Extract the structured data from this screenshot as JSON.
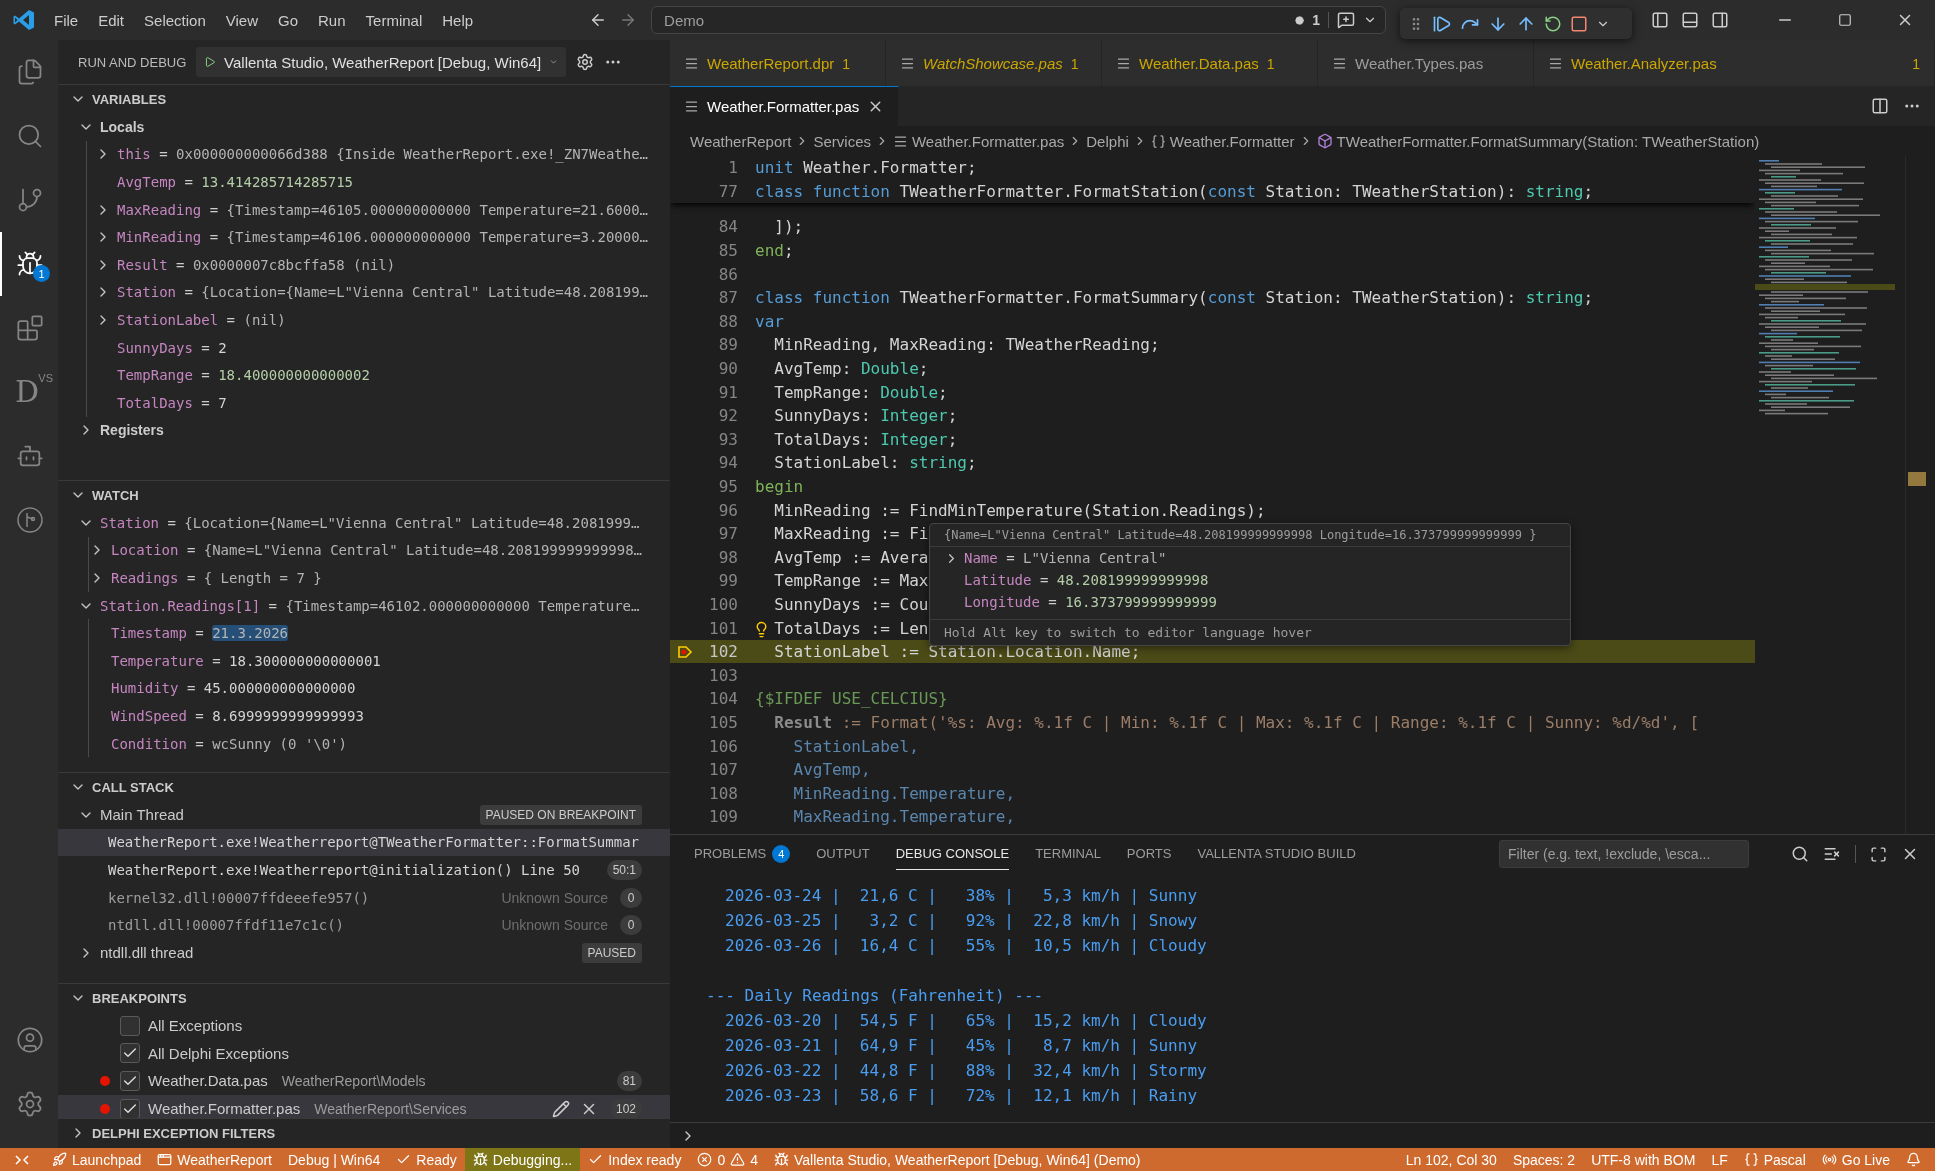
{
  "title_bar": {
    "menu": [
      "File",
      "Edit",
      "Selection",
      "View",
      "Go",
      "Run",
      "Terminal",
      "Help"
    ],
    "command_center": "Demo",
    "notification_count": "1"
  },
  "activity_bar": {
    "items": [
      {
        "kind": "explorer",
        "selected": false
      },
      {
        "kind": "search",
        "selected": false
      },
      {
        "kind": "source-control",
        "selected": false
      },
      {
        "kind": "run-debug",
        "selected": true,
        "badge": "1"
      },
      {
        "kind": "extensions",
        "selected": false
      },
      {
        "kind": "delphi",
        "selected": false,
        "text": "D",
        "superscript": "VS"
      },
      {
        "kind": "assistant",
        "selected": false
      },
      {
        "kind": "deploy",
        "selected": false
      }
    ],
    "bottom": [
      {
        "kind": "account"
      },
      {
        "kind": "settings"
      }
    ]
  },
  "sidebar": {
    "title": "RUN AND DEBUG",
    "launch_config": "Vallenta Studio, WeatherReport [Debug, Win64]",
    "variables": {
      "title": "VARIABLES",
      "expanded": true,
      "scopes": [
        {
          "name": "Locals",
          "expanded": true,
          "children": [
            {
              "name": "this",
              "separator": "=",
              "value": "0x000000000066d388 {Inside WeatherReport.exe!_ZN7Weathe…",
              "kind": "text",
              "expandable": true,
              "expanded": false
            },
            {
              "name": "AvgTemp",
              "separator": "=",
              "value": "13.414285714285715",
              "kind": "number",
              "expandable": false
            },
            {
              "name": "MaxReading",
              "separator": "=",
              "value": "{Timestamp=46105.000000000000 Temperature=21.6000…",
              "kind": "text",
              "expandable": true,
              "expanded": false
            },
            {
              "name": "MinReading",
              "separator": "=",
              "value": "{Timestamp=46106.000000000000 Temperature=3.20000…",
              "kind": "text",
              "expandable": true,
              "expanded": false
            },
            {
              "name": "Result",
              "separator": "=",
              "value": "0x0000007c8bcffa58 (nil)",
              "kind": "text",
              "expandable": true,
              "expanded": false
            },
            {
              "name": "Station",
              "separator": "=",
              "value": "{Location={Name=L\"Vienna Central\" Latitude=48.208199…",
              "kind": "text",
              "expandable": true,
              "expanded": false
            },
            {
              "name": "StationLabel",
              "separator": "=",
              "value": "(nil)",
              "kind": "text",
              "expandable": true,
              "expanded": false
            },
            {
              "name": "SunnyDays",
              "separator": "=",
              "value": "2",
              "kind": "plain",
              "expandable": false
            },
            {
              "name": "TempRange",
              "separator": "=",
              "value": "18.400000000000002",
              "kind": "number",
              "expandable": false
            },
            {
              "name": "TotalDays",
              "separator": "=",
              "value": "7",
              "kind": "plain",
              "expandable": false
            }
          ]
        },
        {
          "name": "Registers",
          "expanded": false
        }
      ]
    },
    "watch": {
      "title": "WATCH",
      "expanded": true,
      "items": [
        {
          "name": "Station",
          "separator": "=",
          "value": "{Location={Name=L\"Vienna Central\" Latitude=48.2081999…",
          "kind": "text",
          "expandable": true,
          "expanded": true,
          "children": [
            {
              "name": "Location",
              "separator": "=",
              "value": "{Name=L\"Vienna Central\" Latitude=48.208199999999998…",
              "kind": "text",
              "expandable": true,
              "expanded": false
            },
            {
              "name": "Readings",
              "separator": "=",
              "value": "{ Length = 7 }",
              "kind": "text",
              "expandable": true,
              "expanded": false
            }
          ]
        },
        {
          "name": "Station.Readings[1]",
          "separator": "=",
          "value": "{Timestamp=46102.000000000000 Temperature…",
          "kind": "text",
          "expandable": true,
          "expanded": true,
          "children": [
            {
              "name": "Timestamp",
              "separator": "=",
              "value": "21.3.2026",
              "kind": "text",
              "expandable": false,
              "highlighted": true
            },
            {
              "name": "Temperature",
              "separator": "=",
              "value": "18.300000000000001",
              "kind": "plain",
              "expandable": false,
              "highlighted": false
            },
            {
              "name": "Humidity",
              "separator": "=",
              "value": "45.000000000000000",
              "kind": "plain",
              "expandable": false,
              "highlighted": false
            },
            {
              "name": "WindSpeed",
              "separator": "=",
              "value": "8.6999999999999993",
              "kind": "plain",
              "expandable": false,
              "highlighted": false
            },
            {
              "name": "Condition",
              "separator": "=",
              "value": "wcSunny (0 '\\0')",
              "kind": "text",
              "expandable": false,
              "highlighted": false
            }
          ]
        }
      ]
    },
    "call_stack": {
      "title": "CALL STACK",
      "expanded": true,
      "threads": [
        {
          "name": "Main Thread",
          "expanded": true,
          "status": "PAUSED ON BREAKPOINT",
          "frames": [
            {
              "label": "WeatherReport.exe!Weatherreport@TWeatherFormatter::FormatSummar",
              "selected": true,
              "dimmed": false
            },
            {
              "label": "WeatherReport.exe!Weatherreport@initialization() Line 50",
              "selected": false,
              "dimmed": false,
              "badge": "50:1"
            },
            {
              "label": "kernel32.dll!00007ffdeeefe957()",
              "selected": false,
              "dimmed": true,
              "source": "Unknown Source",
              "badge": "0"
            },
            {
              "label": "ntdll.dll!00007ffdf11e7c1c()",
              "selected": false,
              "dimmed": true,
              "source": "Unknown Source",
              "badge": "0"
            }
          ]
        },
        {
          "name": "ntdll.dll thread",
          "expanded": false,
          "status": "PAUSED"
        }
      ]
    },
    "breakpoints": {
      "title": "BREAKPOINTS",
      "expanded": true,
      "items": [
        {
          "label": "All Exceptions",
          "checked": false,
          "dot": false,
          "selected": false
        },
        {
          "label": "All Delphi Exceptions",
          "checked": true,
          "dot": false,
          "selected": false
        },
        {
          "label": "Weather.Data.pas",
          "path": "WeatherReport\\Models",
          "checked": true,
          "dot": true,
          "badge": "81",
          "selected": false
        },
        {
          "label": "Weather.Formatter.pas",
          "path": "WeatherReport\\Services",
          "checked": true,
          "dot": true,
          "badge": "102",
          "selected": true
        }
      ]
    },
    "exception_filters": {
      "title": "DELPHI EXCEPTION FILTERS",
      "expanded": false
    }
  },
  "editor": {
    "tab_rows": [
      {
        "tabs": [
          {
            "label": "WeatherReport.dpr",
            "badge": "1",
            "problems": true,
            "preview": false,
            "selected": false
          },
          {
            "label": "WatchShowcase.pas",
            "badge": "1",
            "problems": true,
            "preview": true,
            "selected": false
          },
          {
            "label": "Weather.Data.pas",
            "badge": "1",
            "problems": true,
            "preview": false,
            "selected": false
          },
          {
            "label": "Weather.Types.pas",
            "problems": false,
            "preview": false,
            "selected": false
          },
          {
            "label": "Weather.Analyzer.pas",
            "badge": "1",
            "problems": true,
            "preview": false,
            "selected": false
          }
        ]
      },
      {
        "tabs": [
          {
            "label": "Weather.Formatter.pas",
            "problems": false,
            "preview": false,
            "selected": true
          }
        ]
      }
    ],
    "breadcrumbs": [
      {
        "label": "WeatherReport",
        "kind": "folder"
      },
      {
        "label": "Services",
        "kind": "folder"
      },
      {
        "label": "Weather.Formatter.pas",
        "kind": "file"
      },
      {
        "label": "Delphi",
        "kind": "language"
      },
      {
        "label": "Weather.Formatter",
        "kind": "namespace"
      },
      {
        "label": "TWeatherFormatter.FormatSummary(Station: TWeatherStation)",
        "kind": "method"
      }
    ],
    "sticky_lines": [
      {
        "number": "1",
        "kind": "code",
        "text": "**unit** Weather.Formatter;"
      },
      {
        "number": "77",
        "kind": "code",
        "text": "**class function** TWeatherFormatter.FormatStation(**const** Station: TWeatherStation): *string*;"
      }
    ],
    "lines": [
      {
        "number": "84",
        "kind": "code",
        "text": "  ]);"
      },
      {
        "number": "85",
        "kind": "block",
        "text": "**end**;"
      },
      {
        "number": "86"
      },
      {
        "number": "87",
        "kind": "code",
        "text": "**class function** TWeatherFormatter.FormatSummary(**const** Station: TWeatherStation): *string*;"
      },
      {
        "number": "88",
        "kind": "code",
        "text": "**var**"
      },
      {
        "number": "89",
        "kind": "code",
        "text": "  MinReading, MaxReading: TWeatherReading;"
      },
      {
        "number": "90",
        "kind": "code",
        "text": "  AvgTemp: *Double*;"
      },
      {
        "number": "91",
        "kind": "code",
        "text": "  TempRange: *Double*;"
      },
      {
        "number": "92",
        "kind": "code",
        "text": "  SunnyDays: *Integer*;"
      },
      {
        "number": "93",
        "kind": "code",
        "text": "  TotalDays: *Integer*;"
      },
      {
        "number": "94",
        "kind": "code",
        "text": "  StationLabel: *string*;"
      },
      {
        "number": "95",
        "kind": "block",
        "text": "**begin**"
      },
      {
        "number": "96",
        "kind": "code",
        "text": "  MinReading := FindMinTemperature(Station.Readings);"
      },
      {
        "number": "97",
        "kind": "code",
        "text": "  MaxReading := Fi"
      },
      {
        "number": "98",
        "kind": "code",
        "text": "  AvgTemp := Avera"
      },
      {
        "number": "99",
        "kind": "code",
        "text": "  TempRange := Max"
      },
      {
        "number": "100",
        "kind": "code",
        "text": "  SunnyDays := Cou"
      },
      {
        "number": "101",
        "kind": "code",
        "lightbulb": true,
        "text": "  TotalDays := Len"
      },
      {
        "number": "102",
        "kind": "code",
        "current": true,
        "text": "  StationLabel := Station.Location.Name;"
      },
      {
        "number": "103"
      },
      {
        "number": "104",
        "kind": "comment",
        "text": "{$IFDEF USE_CELCIUS}"
      },
      {
        "number": "105",
        "kind": "inactive",
        "text": "  **Result** := Format('%s: Avg: %.1f C | Min: %.1f C | Max: %.1f C | Range: %.1f C | Sunny: %d/%d', ["
      },
      {
        "number": "106",
        "kind": "inactive-var",
        "text": "    StationLabel,"
      },
      {
        "number": "107",
        "kind": "inactive-var",
        "text": "    AvgTemp,"
      },
      {
        "number": "108",
        "kind": "inactive-var",
        "text": "    MinReading.Temperature,"
      },
      {
        "number": "109",
        "kind": "inactive-var",
        "text": "    MaxReading.Temperature,"
      }
    ],
    "hover": {
      "summary": "{Name=L\"Vienna Central\" Latitude=48.208199999999998 Longitude=16.373799999999999 }",
      "items": [
        {
          "name": "Name",
          "separator": "=",
          "value": "L\"Vienna Central\"",
          "kind": "text",
          "expandable": true
        },
        {
          "name": "Latitude",
          "separator": "=",
          "value": "48.208199999999998",
          "kind": "number",
          "expandable": false
        },
        {
          "name": "Longitude",
          "separator": "=",
          "value": "16.373799999999999",
          "kind": "number",
          "expandable": false
        }
      ],
      "hint": "Hold Alt key to switch to editor language hover"
    }
  },
  "panel": {
    "tabs": [
      {
        "label": "PROBLEMS",
        "badge": "4",
        "selected": false
      },
      {
        "label": "OUTPUT",
        "selected": false
      },
      {
        "label": "DEBUG CONSOLE",
        "selected": true
      },
      {
        "label": "TERMINAL",
        "selected": false
      },
      {
        "label": "PORTS",
        "selected": false
      },
      {
        "label": "VALLENTA STUDIO BUILD",
        "selected": false
      }
    ],
    "filter_placeholder": "Filter (e.g. text, !exclude, \\esca...",
    "console": [
      {
        "kind": "row",
        "text": "2026-03-24 |  21,6 C |   38% |   5,3 km/h | Sunny"
      },
      {
        "kind": "row",
        "text": "2026-03-25 |   3,2 C |   92% |  22,8 km/h | Snowy"
      },
      {
        "kind": "row",
        "text": "2026-03-26 |  16,4 C |   55% |  10,5 km/h | Cloudy"
      },
      {
        "kind": "blank"
      },
      {
        "kind": "heading",
        "text": "--- Daily Readings (Fahrenheit) ---"
      },
      {
        "kind": "row",
        "text": "2026-03-20 |  54,5 F |   65% |  15,2 km/h | Cloudy"
      },
      {
        "kind": "row",
        "text": "2026-03-21 |  64,9 F |   45% |   8,7 km/h | Sunny"
      },
      {
        "kind": "row",
        "text": "2026-03-22 |  44,8 F |   88% |  32,4 km/h | Stormy"
      },
      {
        "kind": "row",
        "text": "2026-03-23 |  58,6 F |   72% |  12,1 km/h | Rainy"
      }
    ]
  },
  "status_bar": {
    "left": [
      {
        "kind": "remote",
        "highlighted": false
      },
      {
        "kind": "launch",
        "text": "Launchpad",
        "highlighted": false
      },
      {
        "kind": "project",
        "text": "WeatherReport",
        "highlighted": false
      },
      {
        "kind": "text",
        "text": "Debug | Win64",
        "highlighted": false
      },
      {
        "kind": "check",
        "text": "Ready",
        "highlighted": false
      },
      {
        "kind": "debug",
        "text": "Debugging...",
        "highlighted": true
      },
      {
        "kind": "check",
        "text": "Index ready",
        "highlighted": false
      },
      {
        "kind": "problems",
        "errors": "0",
        "warnings": "4",
        "highlighted": false
      },
      {
        "kind": "debug",
        "text": "Vallenta Studio, WeatherReport [Debug, Win64] (Demo)",
        "highlighted": false
      }
    ],
    "right": [
      {
        "kind": "text",
        "text": "Ln 102, Col 30"
      },
      {
        "kind": "text",
        "text": "Spaces: 2"
      },
      {
        "kind": "text",
        "text": "UTF-8 with BOM"
      },
      {
        "kind": "text",
        "text": "LF"
      },
      {
        "kind": "language",
        "text": "Pascal"
      },
      {
        "kind": "live",
        "text": "Go Live"
      },
      {
        "kind": "bell"
      }
    ]
  }
}
